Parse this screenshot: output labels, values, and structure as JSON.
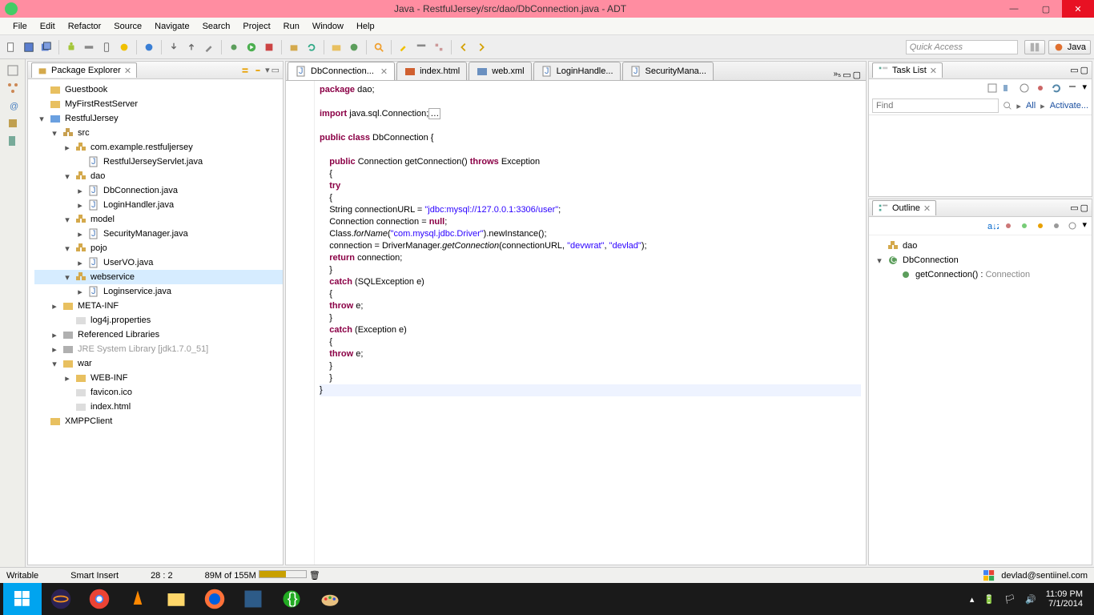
{
  "window": {
    "title": "Java - RestfulJersey/src/dao/DbConnection.java - ADT"
  },
  "menu": [
    "File",
    "Edit",
    "Refactor",
    "Source",
    "Navigate",
    "Search",
    "Project",
    "Run",
    "Window",
    "Help"
  ],
  "quick_access_placeholder": "Quick Access",
  "perspective": {
    "label": "Java"
  },
  "package_explorer": {
    "title": "Package Explorer",
    "nodes": [
      {
        "d": 0,
        "e": "",
        "i": "fld",
        "t": "Guestbook"
      },
      {
        "d": 0,
        "e": "",
        "i": "fld",
        "t": "MyFirstRestServer"
      },
      {
        "d": 0,
        "e": "▾",
        "i": "web",
        "t": "RestfulJersey"
      },
      {
        "d": 1,
        "e": "▾",
        "i": "pkgroot",
        "t": "src"
      },
      {
        "d": 2,
        "e": "▸",
        "i": "pkg",
        "t": "com.example.restfuljersey"
      },
      {
        "d": 3,
        "e": "",
        "i": "java",
        "t": "RestfulJerseyServlet.java"
      },
      {
        "d": 2,
        "e": "▾",
        "i": "pkg",
        "t": "dao"
      },
      {
        "d": 3,
        "e": "▸",
        "i": "java",
        "t": "DbConnection.java"
      },
      {
        "d": 3,
        "e": "▸",
        "i": "java",
        "t": "LoginHandler.java"
      },
      {
        "d": 2,
        "e": "▾",
        "i": "pkg",
        "t": "model"
      },
      {
        "d": 3,
        "e": "▸",
        "i": "java",
        "t": "SecurityManager.java"
      },
      {
        "d": 2,
        "e": "▾",
        "i": "pkg",
        "t": "pojo"
      },
      {
        "d": 3,
        "e": "▸",
        "i": "java",
        "t": "UserVO.java"
      },
      {
        "d": 2,
        "e": "▾",
        "i": "pkg",
        "t": "webservice",
        "sel": true
      },
      {
        "d": 3,
        "e": "▸",
        "i": "java",
        "t": "Loginservice.java"
      },
      {
        "d": 1,
        "e": "▸",
        "i": "fld",
        "t": "META-INF"
      },
      {
        "d": 2,
        "e": "",
        "i": "file",
        "t": "log4j.properties"
      },
      {
        "d": 1,
        "e": "▸",
        "i": "lib",
        "t": "Referenced Libraries"
      },
      {
        "d": 1,
        "e": "▸",
        "i": "lib",
        "t": "JRE System Library [jdk1.7.0_51]",
        "gray": true
      },
      {
        "d": 1,
        "e": "▾",
        "i": "fld",
        "t": "war"
      },
      {
        "d": 2,
        "e": "▸",
        "i": "fld",
        "t": "WEB-INF"
      },
      {
        "d": 2,
        "e": "",
        "i": "file",
        "t": "favicon.ico"
      },
      {
        "d": 2,
        "e": "",
        "i": "file",
        "t": "index.html"
      },
      {
        "d": 0,
        "e": "",
        "i": "fld",
        "t": "XMPPClient"
      }
    ]
  },
  "editor_tabs": [
    {
      "label": "DbConnection...",
      "icon": "java",
      "active": true,
      "close": true
    },
    {
      "label": "index.html",
      "icon": "html"
    },
    {
      "label": "web.xml",
      "icon": "xml"
    },
    {
      "label": "LoginHandle...",
      "icon": "java"
    },
    {
      "label": "SecurityMana...",
      "icon": "java"
    }
  ],
  "code_lines": [
    {
      "indent": 0,
      "parts": [
        {
          "k": "kw",
          "t": "package "
        },
        {
          "t": "dao;"
        }
      ]
    },
    {
      "indent": 0,
      "parts": []
    },
    {
      "indent": 0,
      "fold": "+",
      "parts": [
        {
          "k": "kw",
          "t": "import "
        },
        {
          "t": "java.sql.Connection;"
        },
        {
          "box": true
        }
      ]
    },
    {
      "indent": 0,
      "parts": []
    },
    {
      "indent": 0,
      "parts": [
        {
          "k": "kw",
          "t": "public class "
        },
        {
          "t": "DbConnection {"
        }
      ]
    },
    {
      "indent": 0,
      "parts": []
    },
    {
      "indent": 1,
      "fold": "-",
      "parts": [
        {
          "k": "kw",
          "t": "public "
        },
        {
          "t": "Connection getConnection() "
        },
        {
          "k": "kw",
          "t": "throws "
        },
        {
          "t": "Exception"
        }
      ]
    },
    {
      "indent": 1,
      "parts": [
        {
          "t": "{"
        }
      ]
    },
    {
      "indent": 1,
      "parts": [
        {
          "k": "kw",
          "t": "try"
        }
      ]
    },
    {
      "indent": 1,
      "parts": [
        {
          "t": "{"
        }
      ]
    },
    {
      "indent": 1,
      "parts": [
        {
          "t": "String connectionURL = "
        },
        {
          "k": "str",
          "t": "\"jdbc:mysql://127.0.0.1:3306/user\""
        },
        {
          "t": ";"
        }
      ]
    },
    {
      "indent": 1,
      "parts": [
        {
          "t": "Connection connection = "
        },
        {
          "k": "kw",
          "t": "null"
        },
        {
          "t": ";"
        }
      ]
    },
    {
      "indent": 1,
      "parts": [
        {
          "t": "Class."
        },
        {
          "k": "it",
          "t": "forName"
        },
        {
          "t": "("
        },
        {
          "k": "str",
          "t": "\"com.mysql.jdbc.Driver\""
        },
        {
          "t": ").newInstance();"
        }
      ]
    },
    {
      "indent": 1,
      "parts": [
        {
          "t": "connection = DriverManager."
        },
        {
          "k": "it",
          "t": "getConnection"
        },
        {
          "t": "(connectionURL, "
        },
        {
          "k": "str",
          "t": "\"devwrat\""
        },
        {
          "t": ", "
        },
        {
          "k": "str",
          "t": "\"devlad\""
        },
        {
          "t": ");"
        }
      ]
    },
    {
      "indent": 1,
      "parts": [
        {
          "k": "kw",
          "t": "return "
        },
        {
          "t": "connection;"
        }
      ]
    },
    {
      "indent": 1,
      "parts": [
        {
          "t": "}"
        }
      ]
    },
    {
      "indent": 1,
      "parts": [
        {
          "k": "kw",
          "t": "catch "
        },
        {
          "t": "(SQLException e)"
        }
      ]
    },
    {
      "indent": 1,
      "parts": [
        {
          "t": "{"
        }
      ]
    },
    {
      "indent": 1,
      "parts": [
        {
          "k": "kw",
          "t": "throw "
        },
        {
          "t": "e;"
        }
      ]
    },
    {
      "indent": 1,
      "parts": [
        {
          "t": "}"
        }
      ]
    },
    {
      "indent": 1,
      "parts": [
        {
          "k": "kw",
          "t": "catch "
        },
        {
          "t": "(Exception e)"
        }
      ]
    },
    {
      "indent": 1,
      "parts": [
        {
          "t": "{"
        }
      ]
    },
    {
      "indent": 1,
      "parts": [
        {
          "k": "kw",
          "t": "throw "
        },
        {
          "t": "e;"
        }
      ]
    },
    {
      "indent": 1,
      "parts": [
        {
          "t": "}"
        }
      ]
    },
    {
      "indent": 1,
      "parts": [
        {
          "t": "}"
        }
      ]
    },
    {
      "indent": 0,
      "hl": true,
      "parts": [
        {
          "t": "}"
        }
      ]
    }
  ],
  "tasklist": {
    "title": "Task List",
    "find_placeholder": "Find",
    "all": "All",
    "activate": "Activate..."
  },
  "outline": {
    "title": "Outline",
    "items": [
      {
        "d": 0,
        "e": "",
        "i": "pkg",
        "t": "dao"
      },
      {
        "d": 0,
        "e": "▾",
        "i": "class",
        "t": "DbConnection"
      },
      {
        "d": 1,
        "e": "",
        "i": "method",
        "t": "getConnection() : ",
        "ret": "Connection"
      }
    ]
  },
  "status": {
    "writable": "Writable",
    "insert": "Smart Insert",
    "pos": "28 : 2",
    "mem": "89M of 155M",
    "mem_pct": 57,
    "user": "devlad@sentiinel.com"
  },
  "tray": {
    "time": "11:09 PM",
    "date": "7/1/2014"
  }
}
